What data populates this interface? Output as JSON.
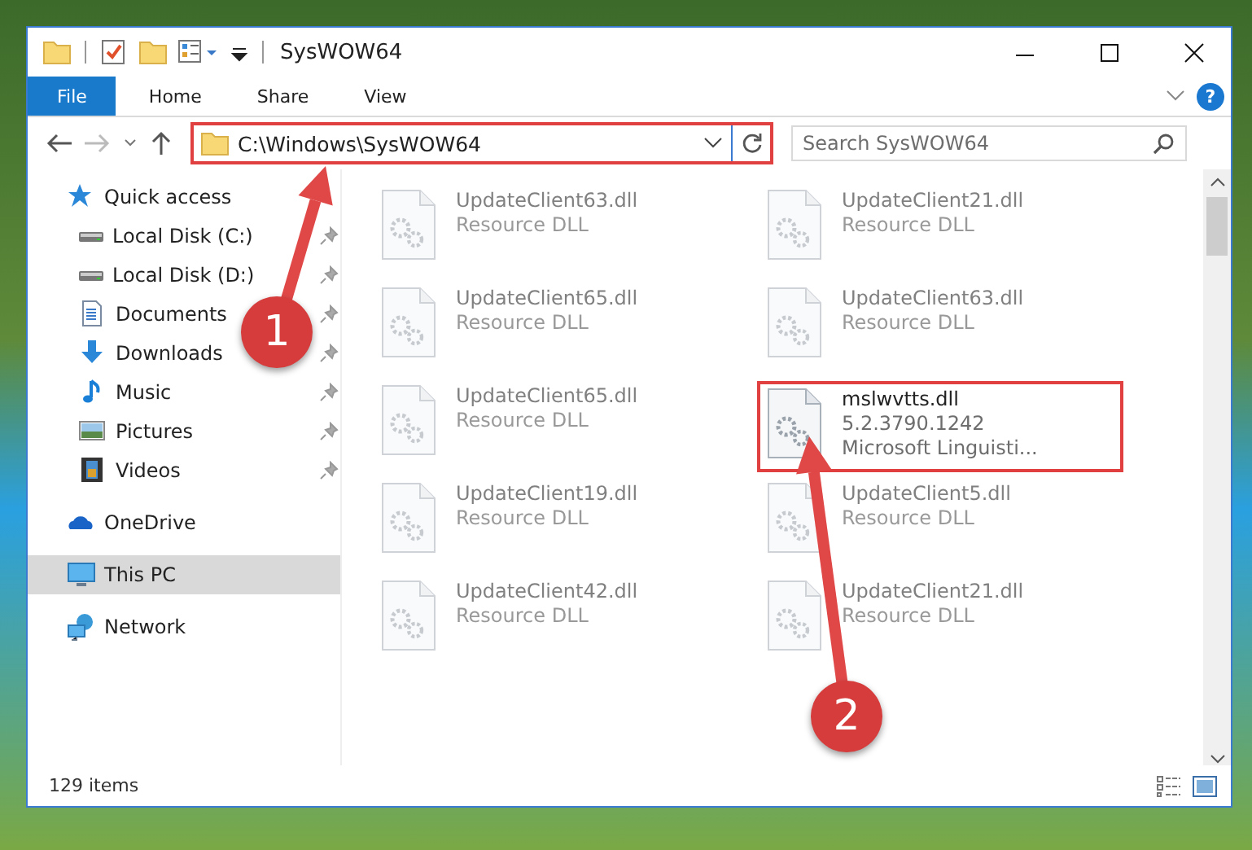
{
  "window": {
    "title": "SysWOW64"
  },
  "ribbon": {
    "tabs": [
      {
        "label": "File",
        "selected": true
      },
      {
        "label": "Home",
        "selected": false
      },
      {
        "label": "Share",
        "selected": false
      },
      {
        "label": "View",
        "selected": false
      }
    ],
    "help": "?"
  },
  "address_bar": {
    "path": "C:\\Windows\\SysWOW64",
    "highlighted": true
  },
  "search": {
    "placeholder": "Search SysWOW64"
  },
  "sidebar": {
    "items": [
      {
        "label": "Quick access",
        "kind": "star",
        "selected": false,
        "children": [
          {
            "label": "Local Disk (C:)",
            "kind": "drive",
            "pinned": true,
            "selected": false
          },
          {
            "label": "Local Disk (D:)",
            "kind": "drive",
            "pinned": true,
            "selected": false
          },
          {
            "label": "Documents",
            "kind": "doc",
            "pinned": true,
            "selected": false
          },
          {
            "label": "Downloads",
            "kind": "download",
            "pinned": true,
            "selected": false
          },
          {
            "label": "Music",
            "kind": "music",
            "pinned": true,
            "selected": false
          },
          {
            "label": "Pictures",
            "kind": "picture",
            "pinned": true,
            "selected": false
          },
          {
            "label": "Videos",
            "kind": "video",
            "pinned": true,
            "selected": false
          }
        ]
      },
      {
        "label": "OneDrive",
        "kind": "cloud",
        "selected": false
      },
      {
        "label": "This PC",
        "kind": "pc",
        "selected": true
      },
      {
        "label": "Network",
        "kind": "network",
        "selected": false
      }
    ]
  },
  "files": [
    {
      "name": "UpdateClient63.dll",
      "lines": [
        "Resource DLL"
      ],
      "dimmed": true,
      "highlighted": false
    },
    {
      "name": "UpdateClient21.dll",
      "lines": [
        "Resource DLL"
      ],
      "dimmed": true,
      "highlighted": false
    },
    {
      "name": "UpdateClient65.dll",
      "lines": [
        "Resource DLL"
      ],
      "dimmed": true,
      "highlighted": false
    },
    {
      "name": "UpdateClient63.dll",
      "lines": [
        "Resource DLL"
      ],
      "dimmed": true,
      "highlighted": false
    },
    {
      "name": "UpdateClient65.dll",
      "lines": [
        "Resource DLL"
      ],
      "dimmed": true,
      "highlighted": false
    },
    {
      "name": "mslwvtts.dll",
      "lines": [
        "5.2.3790.1242",
        "Microsoft Linguisti..."
      ],
      "dimmed": false,
      "highlighted": true
    },
    {
      "name": "UpdateClient19.dll",
      "lines": [
        "Resource DLL"
      ],
      "dimmed": true,
      "highlighted": false
    },
    {
      "name": "UpdateClient5.dll",
      "lines": [
        "Resource DLL"
      ],
      "dimmed": true,
      "highlighted": false
    },
    {
      "name": "UpdateClient42.dll",
      "lines": [
        "Resource DLL"
      ],
      "dimmed": true,
      "highlighted": false
    },
    {
      "name": "UpdateClient21.dll",
      "lines": [
        "Resource DLL"
      ],
      "dimmed": true,
      "highlighted": false
    }
  ],
  "status_bar": {
    "count": "129 items"
  },
  "callouts": [
    {
      "number": "1"
    },
    {
      "number": "2"
    }
  ]
}
